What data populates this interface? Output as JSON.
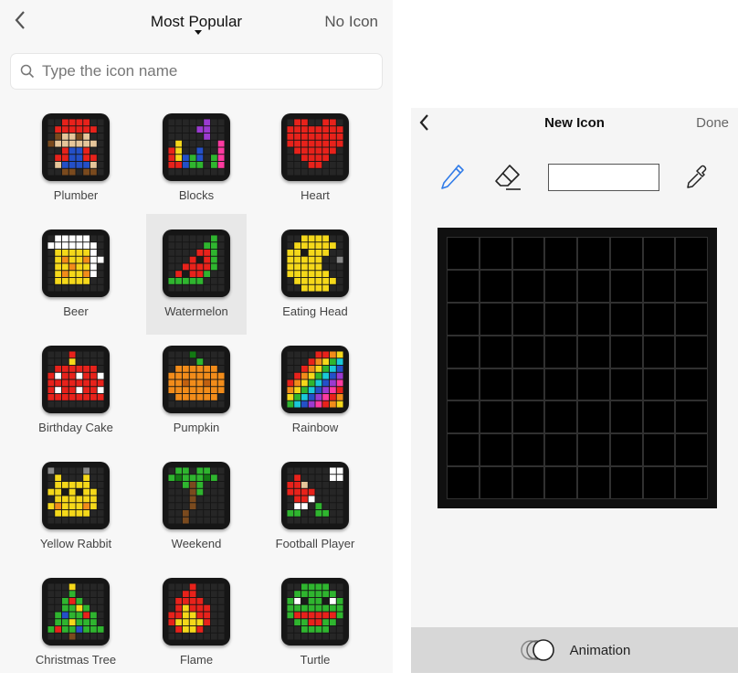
{
  "left_panel": {
    "title": "Most Popular",
    "no_icon_label": "No Icon",
    "search_placeholder": "Type the icon name",
    "icons": [
      {
        "label": "Plumber"
      },
      {
        "label": "Blocks"
      },
      {
        "label": "Heart"
      },
      {
        "label": "Beer"
      },
      {
        "label": "Watermelon",
        "selected": true
      },
      {
        "label": "Eating Head"
      },
      {
        "label": "Birthday Cake"
      },
      {
        "label": "Pumpkin"
      },
      {
        "label": "Rainbow"
      },
      {
        "label": "Yellow Rabbit"
      },
      {
        "label": "Weekend"
      },
      {
        "label": "Football Player"
      },
      {
        "label": "Christmas Tree"
      },
      {
        "label": "Flame"
      },
      {
        "label": "Turtle"
      }
    ]
  },
  "right_panel": {
    "title": "New Icon",
    "done_label": "Done",
    "tools": {
      "pencil": "pencil-icon",
      "eraser": "eraser-icon",
      "eyedropper": "eyedropper-icon"
    },
    "selected_color": "#ffffff",
    "canvas": {
      "rows": 8,
      "cols": 8
    },
    "animation_label": "Animation"
  },
  "colors": {
    "accent_blue": "#2f7be8",
    "canvas_background": "#000000"
  }
}
